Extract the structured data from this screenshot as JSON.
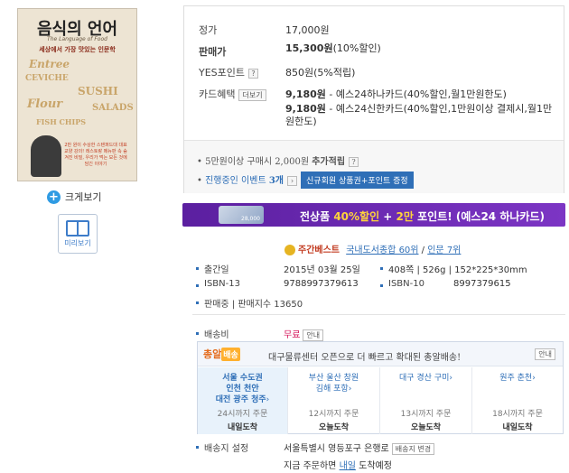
{
  "book": {
    "cover_title": "음식의 언어",
    "cover_subtitle": "The Language of Food",
    "cover_tagline": "세상에서 가장 맛있는 인문학",
    "cover_words": [
      "Entree",
      "CEVICHE",
      "SUSHI",
      "Flour",
      "SALADS",
      "FISH CHIPS"
    ],
    "cover_blurb": "2만 원이 수상한 스탠퍼드대 대표 교양 강의! 레스토랑 메뉴판 속 숨겨진 비밀, 우리가 먹는 모든 것에 담긴 이야기"
  },
  "left": {
    "zoom_label": "크게보기",
    "preview_label": "미리보기"
  },
  "price": {
    "list_label": "정가",
    "list_value": "17,000원",
    "sale_label": "판매가",
    "sale_value": "15,300원",
    "sale_discount": "(10%할인)",
    "points_label": "YES포인트",
    "points_value": "850원(5%적립)",
    "card_label": "카드혜택",
    "card_more": "더보기",
    "card_lines": [
      {
        "price": "9,180원",
        "desc": " - 예스24하나카드(40%할인,월1만원한도)"
      },
      {
        "price": "9,180원",
        "desc": " - 예스24신한카드(40%할인,1만원이상 결제시,월1만원한도)"
      }
    ],
    "bonus_prefix": "5만원이상 구매시 2,000원 ",
    "bonus_strong": "추가적립",
    "event_prefix": "진행중인 이벤트 ",
    "event_count": "3개",
    "event_button": "신규회원 상품권+포인트 증정"
  },
  "banner": {
    "card_amount": "28,000",
    "text_white_1": "전상품 ",
    "text_yellow_1": "40%할인",
    "text_white_2": " + ",
    "text_yellow_2": "2만",
    "text_white_3": " 포인트! (예스24 하나카드)"
  },
  "rank": {
    "label": "주간베스트",
    "cat1": "국내도서종합 60위",
    "divider": " / ",
    "cat2": "인문 7위"
  },
  "info": {
    "pubdate_label": "출간일",
    "pubdate_value": "2015년 03월 25일",
    "pages_value": "408쪽 | 526g | 152*225*30mm",
    "isbn13_label": "ISBN-13",
    "isbn13_value": "9788997379613",
    "isbn10_label": "ISBN-10",
    "isbn10_value": "8997379615",
    "sales_label": "판매중 | 판매지수 13650"
  },
  "shipping": {
    "fee_label": "배송비",
    "fee_value": "무료",
    "fee_guide": "안내",
    "logo_text": "총알",
    "logo_badge": "배송",
    "msg": "대구물류센터 오픈으로 더 빠르고 확대된 총알배송!",
    "guide": "안내",
    "columns": [
      {
        "region_lines": [
          "서울 수도권",
          "인천 천안",
          "대전 광주 청주"
        ],
        "cutoff": "24시까지 주문",
        "arrival": "내일도착"
      },
      {
        "region_lines": [
          "부산 울산 창원",
          "김해 포항"
        ],
        "cutoff": "12시까지 주문",
        "arrival": "오늘도착"
      },
      {
        "region_lines": [
          "대구 경산 구미"
        ],
        "cutoff": "13시까지 주문",
        "arrival": "오늘도착"
      },
      {
        "region_lines": [
          "원주 춘천"
        ],
        "cutoff": "18시까지 주문",
        "arrival": "내일도착"
      }
    ],
    "addr_label": "배송지 설정",
    "addr_value": "서울특별시 영등포구 은행로",
    "addr_change": "배송지 변경",
    "eta_prefix": "지금 주문하면 ",
    "eta_day": "내일",
    "eta_suffix": " 도착예정"
  },
  "colors": {
    "accent": "#d5145a",
    "link": "#2f6fb7",
    "banner": "#5b1fa0"
  }
}
